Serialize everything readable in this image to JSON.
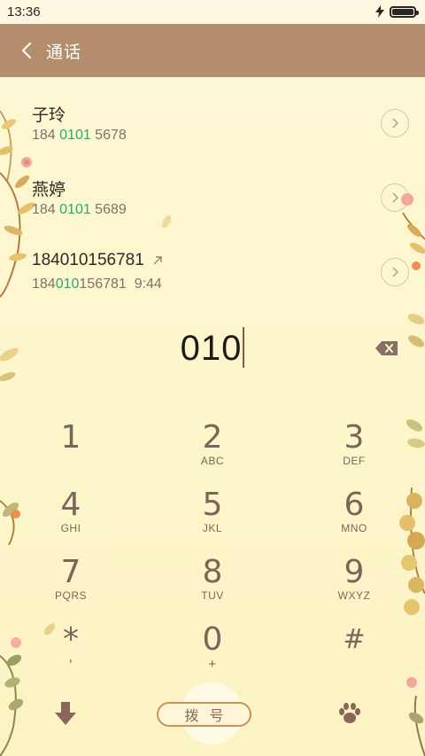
{
  "status_bar": {
    "time": "13:36"
  },
  "header": {
    "title": "通话"
  },
  "contacts": [
    {
      "name": "子玲",
      "number_prefix": "184 ",
      "number_match": "0101",
      "number_suffix": " 5678"
    },
    {
      "name": "燕婷",
      "number_prefix": "184 ",
      "number_match": "0101",
      "number_suffix": " 5689"
    },
    {
      "name": "184010156781",
      "number_prefix": "184",
      "number_match": "010",
      "number_suffix": "156781",
      "time": "9:44"
    }
  ],
  "dialer": {
    "input": "010"
  },
  "keypad": [
    {
      "digit": "1",
      "letters": ""
    },
    {
      "digit": "2",
      "letters": "ABC"
    },
    {
      "digit": "3",
      "letters": "DEF"
    },
    {
      "digit": "4",
      "letters": "GHI"
    },
    {
      "digit": "5",
      "letters": "JKL"
    },
    {
      "digit": "6",
      "letters": "MNO"
    },
    {
      "digit": "7",
      "letters": "PQRS"
    },
    {
      "digit": "8",
      "letters": "TUV"
    },
    {
      "digit": "9",
      "letters": "WXYZ"
    },
    {
      "digit": "*",
      "letters": ","
    },
    {
      "digit": "0",
      "letters": "+"
    },
    {
      "digit": "#",
      "letters": ""
    }
  ],
  "bottom_bar": {
    "call_label": "拨号"
  },
  "icons": {
    "back": "chevron-left-icon",
    "info": "chevron-right-circle-icon",
    "outgoing": "arrow-up-right-icon",
    "backspace": "backspace-icon",
    "collapse": "arrow-down-icon",
    "theme": "paw-icon",
    "charging": "bolt-icon",
    "battery": "battery-icon"
  },
  "colors": {
    "header": "#b48e6c",
    "background": "#fdf6cc",
    "match_highlight": "#3aa36a",
    "key_text": "#7a6558"
  }
}
